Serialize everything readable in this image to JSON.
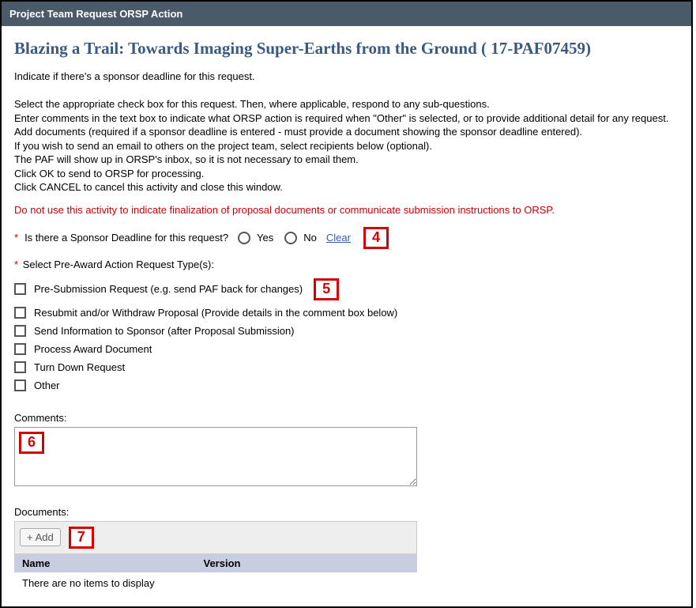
{
  "window_title": "Project Team Request ORSP Action",
  "page_title": "Blazing a Trail: Towards Imaging Super-Earths from the Ground ( 17-PAF07459)",
  "instructions": {
    "lead": "Indicate if there's a sponsor deadline for this request.",
    "lines": [
      "Select the appropriate check box for this request. Then, where applicable, respond to any sub-questions.",
      "Enter comments in the text box to indicate what ORSP action is required when \"Other\" is selected, or to provide additional detail for any request.",
      "Add documents (required if a sponsor deadline is entered - must provide a document showing the sponsor deadline entered).",
      "If you wish to send an email to others on the project team, select recipients below (optional).",
      "The PAF will show up in ORSP's inbox, so it is not necessary to email them.",
      "Click OK to send to ORSP for processing.",
      "Click CANCEL to cancel this activity and close this window."
    ]
  },
  "warning": "Do not use this activity to indicate finalization of proposal documents or communicate submission instructions to ORSP.",
  "sponsor_deadline": {
    "label": "Is there a Sponsor Deadline for this request?",
    "yes": "Yes",
    "no": "No",
    "clear": "Clear"
  },
  "action_type": {
    "label": "Select Pre-Award Action Request Type(s):",
    "options": [
      "Pre-Submission Request (e.g. send PAF back for changes)",
      "Resubmit and/or Withdraw Proposal (Provide details in the comment box below)",
      "Send Information to Sponsor (after Proposal Submission)",
      "Process Award Document",
      "Turn Down Request",
      "Other"
    ]
  },
  "comments": {
    "label": "Comments:",
    "value": ""
  },
  "documents": {
    "label": "Documents:",
    "add_label": "Add",
    "columns": {
      "name": "Name",
      "version": "Version"
    },
    "empty": "There are no items to display"
  },
  "annotations": {
    "a4": "4",
    "a5": "5",
    "a6": "6",
    "a7": "7"
  }
}
